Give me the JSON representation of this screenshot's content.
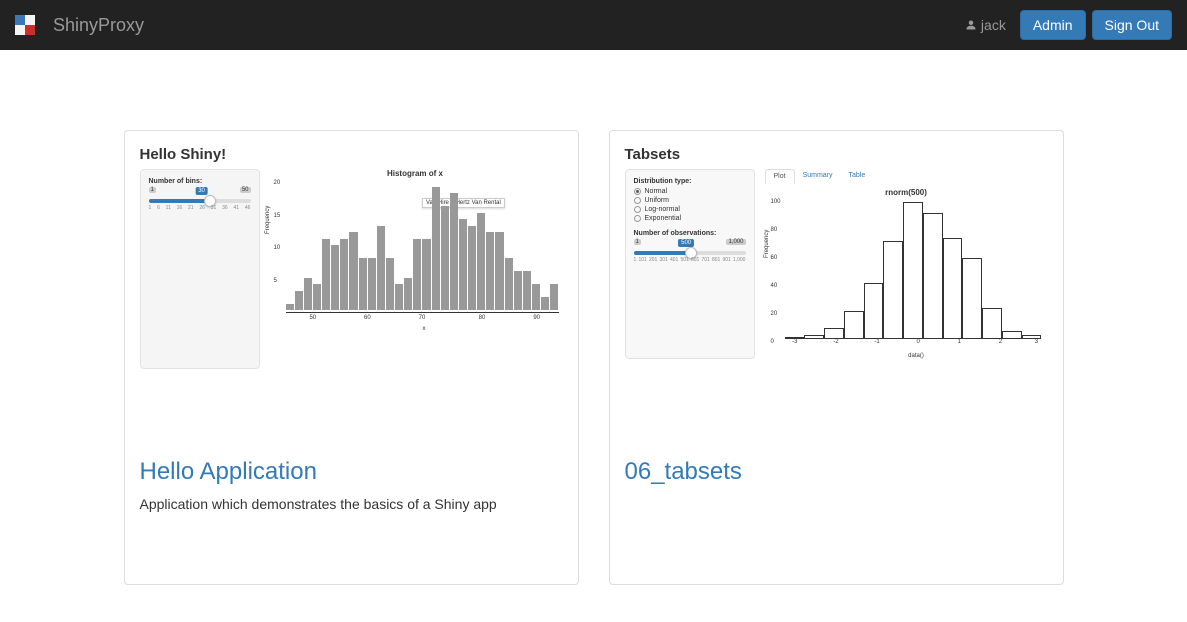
{
  "navbar": {
    "brand": "ShinyProxy",
    "user_label": "jack",
    "admin_button": "Admin",
    "signout_button": "Sign Out"
  },
  "cards": [
    {
      "title": "Hello Application",
      "description": "Application which demonstrates the basics of a Shiny app",
      "preview": {
        "heading": "Hello Shiny!",
        "slider_label": "Number of bins:",
        "slider_value": "30",
        "slider_min": "1",
        "slider_max": "50",
        "slider_ticks": [
          "1",
          "6",
          "11",
          "16",
          "21",
          "26",
          "31",
          "36",
          "41",
          "46"
        ],
        "plot_title": "Histogram of x",
        "tooltip": "Van Hire – Hertz Van Rental",
        "ylabel": "Frequency",
        "xlabel": "x",
        "yticks": [
          {
            "v": "5",
            "pct": 75
          },
          {
            "v": "10",
            "pct": 50
          },
          {
            "v": "15",
            "pct": 25
          },
          {
            "v": "20",
            "pct": 0
          }
        ],
        "xticks": [
          {
            "v": "50",
            "pct": 10
          },
          {
            "v": "60",
            "pct": 30
          },
          {
            "v": "70",
            "pct": 50
          },
          {
            "v": "80",
            "pct": 72
          },
          {
            "v": "90",
            "pct": 92
          }
        ]
      }
    },
    {
      "title": "06_tabsets",
      "description": "",
      "preview": {
        "heading": "Tabsets",
        "dist_label": "Distribution type:",
        "dist_options": [
          "Normal",
          "Uniform",
          "Log-normal",
          "Exponential"
        ],
        "dist_selected": "Normal",
        "obs_label": "Number of observations:",
        "obs_value": "500",
        "obs_min": "1",
        "obs_max": "1,000",
        "obs_ticks": [
          "1",
          "101",
          "201",
          "301",
          "401",
          "501",
          "601",
          "701",
          "801",
          "901",
          "1,000"
        ],
        "tabs": [
          "Plot",
          "Summary",
          "Table"
        ],
        "tab_active": "Plot",
        "plot_title": "rnorm(500)",
        "ylabel": "Frequency",
        "xlabel": "data()",
        "yticks": [
          {
            "v": "0",
            "pct": 100
          },
          {
            "v": "20",
            "pct": 80
          },
          {
            "v": "40",
            "pct": 60
          },
          {
            "v": "60",
            "pct": 40
          },
          {
            "v": "80",
            "pct": 20
          },
          {
            "v": "100",
            "pct": 0
          }
        ],
        "xticks": [
          {
            "v": "-3",
            "pct": 4
          },
          {
            "v": "-2",
            "pct": 20
          },
          {
            "v": "-1",
            "pct": 36
          },
          {
            "v": "0",
            "pct": 52
          },
          {
            "v": "1",
            "pct": 68
          },
          {
            "v": "2",
            "pct": 84
          },
          {
            "v": "3",
            "pct": 98
          }
        ]
      }
    }
  ],
  "chart_data": [
    {
      "type": "bar",
      "title": "Histogram of x",
      "xlabel": "x",
      "ylabel": "Frequency",
      "ylim": [
        0,
        20
      ],
      "values": [
        1,
        3,
        5,
        4,
        11,
        10,
        11,
        12,
        8,
        8,
        13,
        8,
        4,
        5,
        11,
        11,
        19,
        16,
        18,
        14,
        13,
        15,
        12,
        12,
        8,
        6,
        6,
        4,
        2,
        4
      ]
    },
    {
      "type": "bar",
      "title": "rnorm(500)",
      "xlabel": "data()",
      "ylabel": "Frequency",
      "ylim": [
        0,
        100
      ],
      "categories": [
        -3,
        -2.5,
        -2,
        -1.5,
        -1,
        -0.5,
        0,
        0.5,
        1,
        1.5,
        2,
        2.5,
        3
      ],
      "values": [
        0,
        3,
        8,
        20,
        40,
        70,
        98,
        90,
        72,
        58,
        22,
        6,
        3
      ]
    }
  ]
}
